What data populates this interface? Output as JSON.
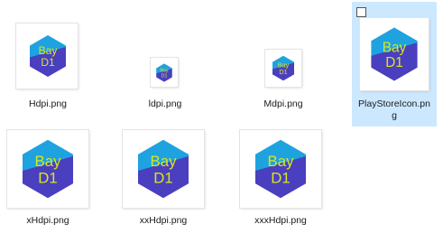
{
  "colors": {
    "hex_top": "#1fa2e0",
    "hex_bottom": "#4a3fbf",
    "icon_text": "#d8e620",
    "selection": "#cce8ff"
  },
  "icon": {
    "line1": "Bay",
    "line2": "D1"
  },
  "files": [
    {
      "name": "Hdpi.png"
    },
    {
      "name": "ldpi.png"
    },
    {
      "name": "Mdpi.png"
    },
    {
      "name_line1": "PlayStoreIcon.pn",
      "name_line2": "g",
      "selected": true
    },
    {
      "name": "xHdpi.png"
    },
    {
      "name": "xxHdpi.png"
    },
    {
      "name": "xxxHdpi.png"
    }
  ]
}
